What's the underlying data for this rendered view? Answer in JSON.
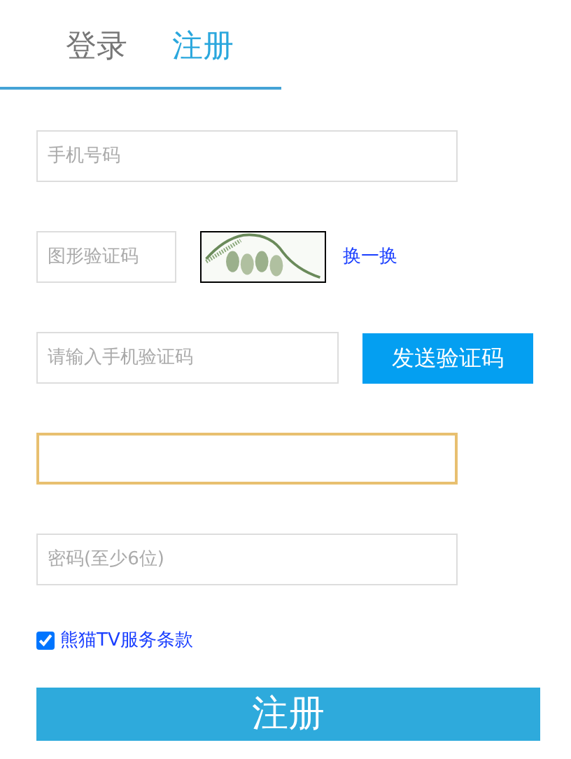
{
  "tabs": [
    {
      "label": "登录",
      "selected": false
    },
    {
      "label": "注册",
      "selected": true
    }
  ],
  "phone_field": {
    "placeholder": "手机号码",
    "focused": false
  },
  "captcha": {
    "field": {
      "placeholder": "图形验证码"
    },
    "refresh_link": "换一换"
  },
  "sms": {
    "field": {
      "placeholder": "请输入手机验证码"
    },
    "button": "发送验证码"
  },
  "extra_field": {
    "focused": true
  },
  "password_field": {
    "placeholder": "密码(至少6位)",
    "focused": false
  },
  "terms": {
    "checked": true,
    "label": "熊猫TV服务条款"
  },
  "submit_button": "注册"
}
